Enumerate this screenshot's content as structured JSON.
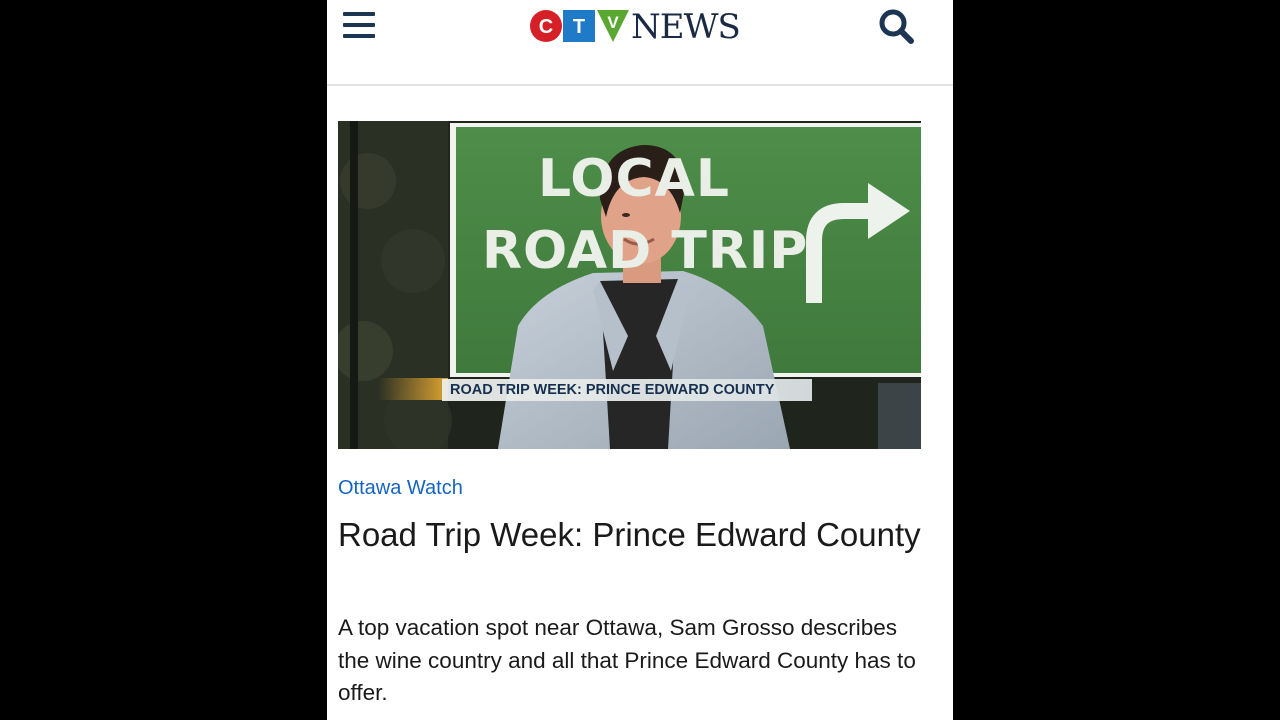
{
  "header": {
    "menu_icon": "hamburger-menu-icon",
    "logo_letters": [
      "C",
      "T",
      "V"
    ],
    "logo_text": "NEWS",
    "search_icon": "search-icon",
    "colors": {
      "red": "#d62027",
      "blue": "#1f7ac7",
      "green": "#5aa832",
      "navy": "#1b3553"
    }
  },
  "hero": {
    "sign_line1": "LOCAL",
    "sign_line2": "ROAD TRIP",
    "lower_third": "ROAD TRIP WEEK: PRINCE EDWARD COUNTY"
  },
  "article": {
    "section": "Ottawa Watch",
    "headline": "Road Trip Week: Prince Edward County",
    "summary": "A top vacation spot near Ottawa, Sam Grosso describes the wine country and all that Prince Edward County has to offer.",
    "accent_color": "#1565c0"
  }
}
